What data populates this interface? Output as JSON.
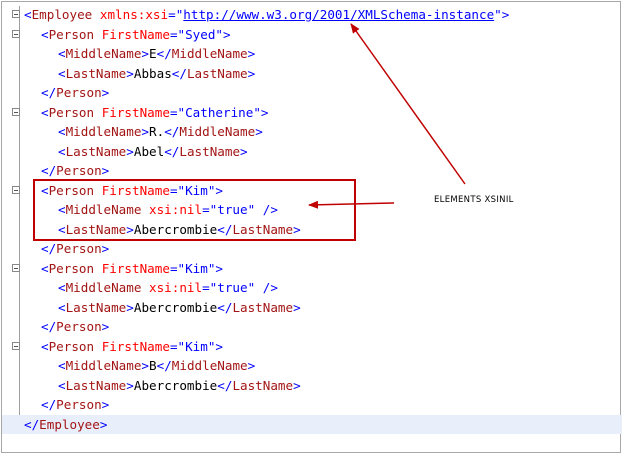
{
  "editor": {
    "lines": [
      {
        "indent": 0,
        "fold": true,
        "parts": [
          [
            "b",
            "<"
          ],
          [
            "r",
            "Employee"
          ],
          [
            "k",
            " "
          ],
          [
            "a",
            "xmlns:xsi"
          ],
          [
            "b",
            "=\""
          ],
          [
            "u",
            "http://www.w3.org/2001/XMLSchema-instance"
          ],
          [
            "b",
            "\">"
          ]
        ]
      },
      {
        "indent": 1,
        "fold": true,
        "parts": [
          [
            "b",
            "<"
          ],
          [
            "r",
            "Person"
          ],
          [
            "k",
            " "
          ],
          [
            "a",
            "FirstName"
          ],
          [
            "b",
            "=\"Syed\">"
          ]
        ]
      },
      {
        "indent": 2,
        "fold": false,
        "parts": [
          [
            "b",
            "<"
          ],
          [
            "r",
            "MiddleName"
          ],
          [
            "b",
            ">"
          ],
          [
            "k",
            "E"
          ],
          [
            "b",
            "</"
          ],
          [
            "r",
            "MiddleName"
          ],
          [
            "b",
            ">"
          ]
        ]
      },
      {
        "indent": 2,
        "fold": false,
        "parts": [
          [
            "b",
            "<"
          ],
          [
            "r",
            "LastName"
          ],
          [
            "b",
            ">"
          ],
          [
            "k",
            "Abbas"
          ],
          [
            "b",
            "</"
          ],
          [
            "r",
            "LastName"
          ],
          [
            "b",
            ">"
          ]
        ]
      },
      {
        "indent": 1,
        "fold": false,
        "parts": [
          [
            "b",
            "</"
          ],
          [
            "r",
            "Person"
          ],
          [
            "b",
            ">"
          ]
        ]
      },
      {
        "indent": 1,
        "fold": true,
        "parts": [
          [
            "b",
            "<"
          ],
          [
            "r",
            "Person"
          ],
          [
            "k",
            " "
          ],
          [
            "a",
            "FirstName"
          ],
          [
            "b",
            "=\"Catherine\">"
          ]
        ]
      },
      {
        "indent": 2,
        "fold": false,
        "parts": [
          [
            "b",
            "<"
          ],
          [
            "r",
            "MiddleName"
          ],
          [
            "b",
            ">"
          ],
          [
            "k",
            "R."
          ],
          [
            "b",
            "</"
          ],
          [
            "r",
            "MiddleName"
          ],
          [
            "b",
            ">"
          ]
        ]
      },
      {
        "indent": 2,
        "fold": false,
        "parts": [
          [
            "b",
            "<"
          ],
          [
            "r",
            "LastName"
          ],
          [
            "b",
            ">"
          ],
          [
            "k",
            "Abel"
          ],
          [
            "b",
            "</"
          ],
          [
            "r",
            "LastName"
          ],
          [
            "b",
            ">"
          ]
        ]
      },
      {
        "indent": 1,
        "fold": false,
        "parts": [
          [
            "b",
            "</"
          ],
          [
            "r",
            "Person"
          ],
          [
            "b",
            ">"
          ]
        ]
      },
      {
        "indent": 1,
        "fold": true,
        "parts": [
          [
            "b",
            "<"
          ],
          [
            "r",
            "Person"
          ],
          [
            "k",
            " "
          ],
          [
            "a",
            "FirstName"
          ],
          [
            "b",
            "=\"Kim\">"
          ]
        ]
      },
      {
        "indent": 2,
        "fold": false,
        "parts": [
          [
            "b",
            "<"
          ],
          [
            "r",
            "MiddleName"
          ],
          [
            "k",
            " "
          ],
          [
            "a",
            "xsi:nil"
          ],
          [
            "b",
            "=\"true\" />"
          ]
        ]
      },
      {
        "indent": 2,
        "fold": false,
        "parts": [
          [
            "b",
            "<"
          ],
          [
            "r",
            "LastName"
          ],
          [
            "b",
            ">"
          ],
          [
            "k",
            "Abercrombie"
          ],
          [
            "b",
            "</"
          ],
          [
            "r",
            "LastName"
          ],
          [
            "b",
            ">"
          ]
        ]
      },
      {
        "indent": 1,
        "fold": false,
        "parts": [
          [
            "b",
            "</"
          ],
          [
            "r",
            "Person"
          ],
          [
            "b",
            ">"
          ]
        ]
      },
      {
        "indent": 1,
        "fold": true,
        "parts": [
          [
            "b",
            "<"
          ],
          [
            "r",
            "Person"
          ],
          [
            "k",
            " "
          ],
          [
            "a",
            "FirstName"
          ],
          [
            "b",
            "=\"Kim\">"
          ]
        ]
      },
      {
        "indent": 2,
        "fold": false,
        "parts": [
          [
            "b",
            "<"
          ],
          [
            "r",
            "MiddleName"
          ],
          [
            "k",
            " "
          ],
          [
            "a",
            "xsi:nil"
          ],
          [
            "b",
            "=\"true\" />"
          ]
        ]
      },
      {
        "indent": 2,
        "fold": false,
        "parts": [
          [
            "b",
            "<"
          ],
          [
            "r",
            "LastName"
          ],
          [
            "b",
            ">"
          ],
          [
            "k",
            "Abercrombie"
          ],
          [
            "b",
            "</"
          ],
          [
            "r",
            "LastName"
          ],
          [
            "b",
            ">"
          ]
        ]
      },
      {
        "indent": 1,
        "fold": false,
        "parts": [
          [
            "b",
            "</"
          ],
          [
            "r",
            "Person"
          ],
          [
            "b",
            ">"
          ]
        ]
      },
      {
        "indent": 1,
        "fold": true,
        "parts": [
          [
            "b",
            "<"
          ],
          [
            "r",
            "Person"
          ],
          [
            "k",
            " "
          ],
          [
            "a",
            "FirstName"
          ],
          [
            "b",
            "=\"Kim\">"
          ]
        ]
      },
      {
        "indent": 2,
        "fold": false,
        "parts": [
          [
            "b",
            "<"
          ],
          [
            "r",
            "MiddleName"
          ],
          [
            "b",
            ">"
          ],
          [
            "k",
            "B"
          ],
          [
            "b",
            "</"
          ],
          [
            "r",
            "MiddleName"
          ],
          [
            "b",
            ">"
          ]
        ]
      },
      {
        "indent": 2,
        "fold": false,
        "parts": [
          [
            "b",
            "<"
          ],
          [
            "r",
            "LastName"
          ],
          [
            "b",
            ">"
          ],
          [
            "k",
            "Abercrombie"
          ],
          [
            "b",
            "</"
          ],
          [
            "r",
            "LastName"
          ],
          [
            "b",
            ">"
          ]
        ]
      },
      {
        "indent": 1,
        "fold": false,
        "parts": [
          [
            "b",
            "</"
          ],
          [
            "r",
            "Person"
          ],
          [
            "b",
            ">"
          ]
        ]
      },
      {
        "indent": 0,
        "fold": false,
        "parts": [
          [
            "b",
            "</"
          ],
          [
            "r",
            "Employee"
          ],
          [
            "b",
            ">"
          ]
        ]
      }
    ]
  },
  "annotation": {
    "label": "ELEMENTS XSINIL",
    "color": "#c00000"
  },
  "colors": {
    "tag_bracket": "#0000ff",
    "element_name": "#a31515",
    "attribute_name": "#ff0000",
    "text": "#000000"
  }
}
